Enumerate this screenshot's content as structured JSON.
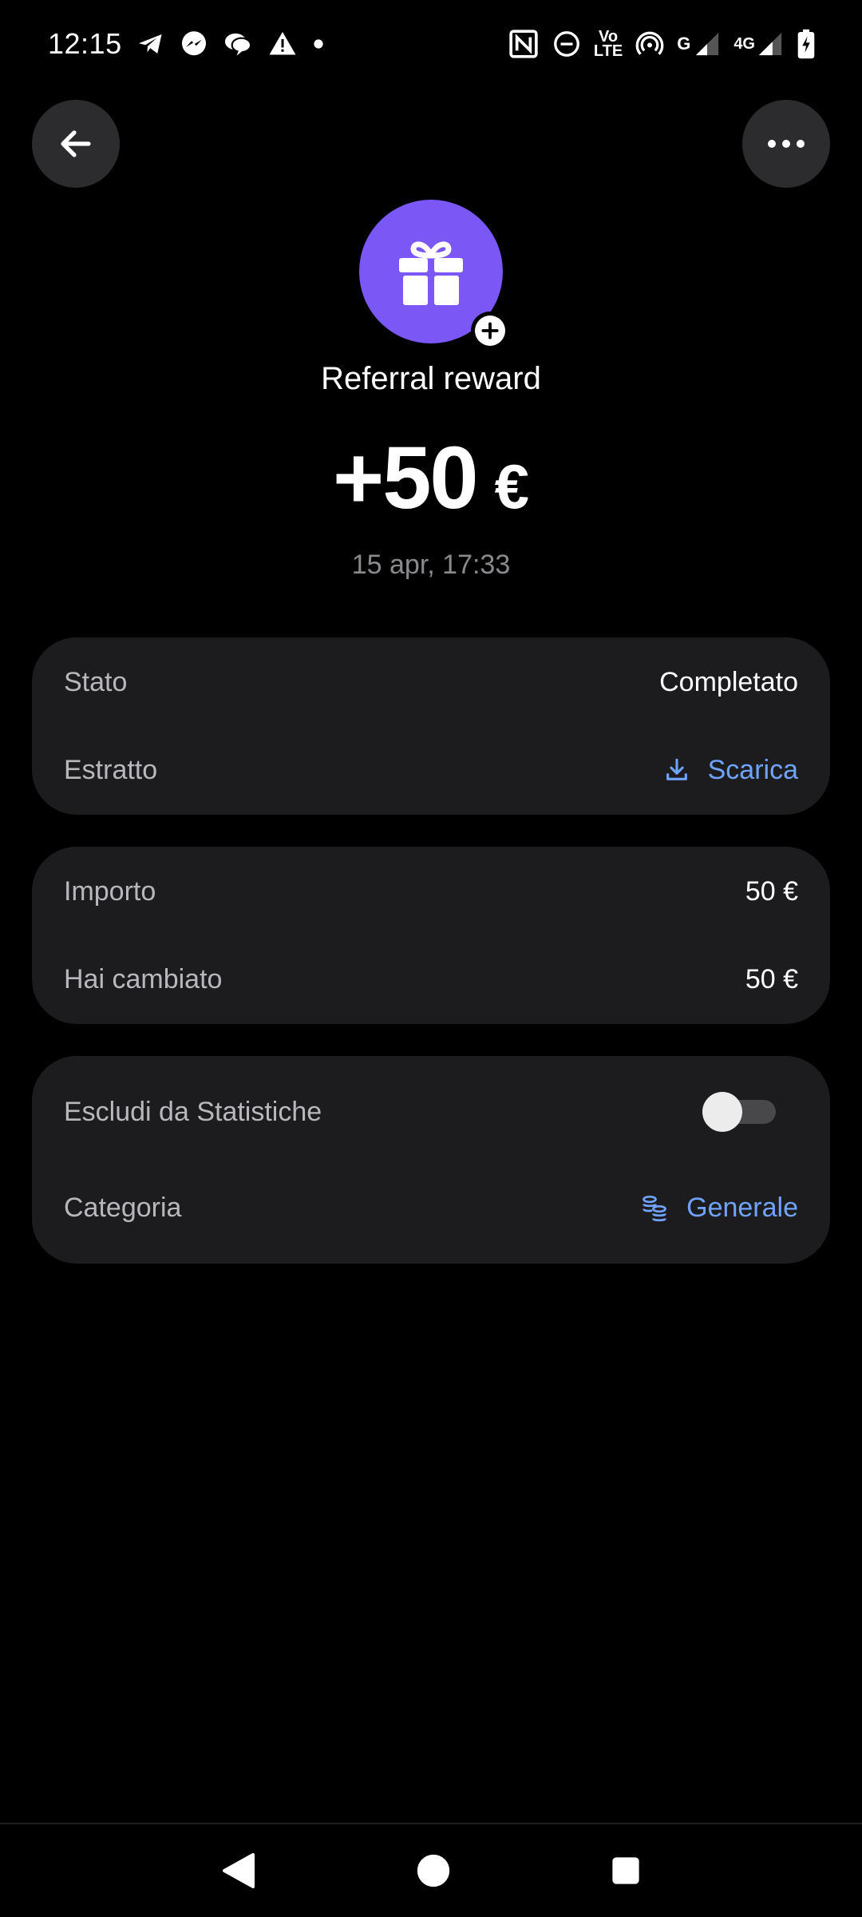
{
  "status_bar": {
    "time": "12:15",
    "left_icons": [
      "telegram-icon",
      "messenger-icon",
      "chat-bubbles-icon",
      "warning-icon",
      "dot-icon"
    ],
    "right_icons": [
      "nfc-icon",
      "do-not-disturb-icon",
      "volte-icon",
      "hotspot-icon",
      "signal-icon",
      "signal-4g-icon",
      "battery-charging-icon"
    ],
    "volte_top": "Vo",
    "volte_bottom": "LTE",
    "network_g": "G",
    "network_4g": "4G"
  },
  "header": {
    "back_icon": "arrow-left-icon",
    "more_icon": "more-horizontal-icon",
    "avatar_icon": "gift-icon",
    "avatar_color": "#7b57f6",
    "badge_icon": "plus-icon",
    "title": "Referral reward",
    "amount": "+50",
    "currency": "€",
    "date": "15 apr, 17:33"
  },
  "details_card": {
    "status_label": "Stato",
    "status_value": "Completato",
    "statement_label": "Estratto",
    "statement_action": "Scarica",
    "statement_icon": "download-icon"
  },
  "amount_card": {
    "amount_label": "Importo",
    "amount_value": "50 €",
    "exchanged_label": "Hai cambiato",
    "exchanged_value": "50 €"
  },
  "settings_card": {
    "exclude_label": "Escludi da Statistiche",
    "exclude_enabled": false,
    "category_label": "Categoria",
    "category_value": "Generale",
    "category_icon": "coins-icon"
  },
  "colors": {
    "background": "#000000",
    "card": "#1c1c1e",
    "accent_link": "#6fa3ff",
    "avatar": "#7b57f6",
    "muted_text": "#8a8a8e"
  },
  "nav_bar": {
    "icons": [
      "nav-back-icon",
      "nav-home-icon",
      "nav-recents-icon"
    ]
  }
}
